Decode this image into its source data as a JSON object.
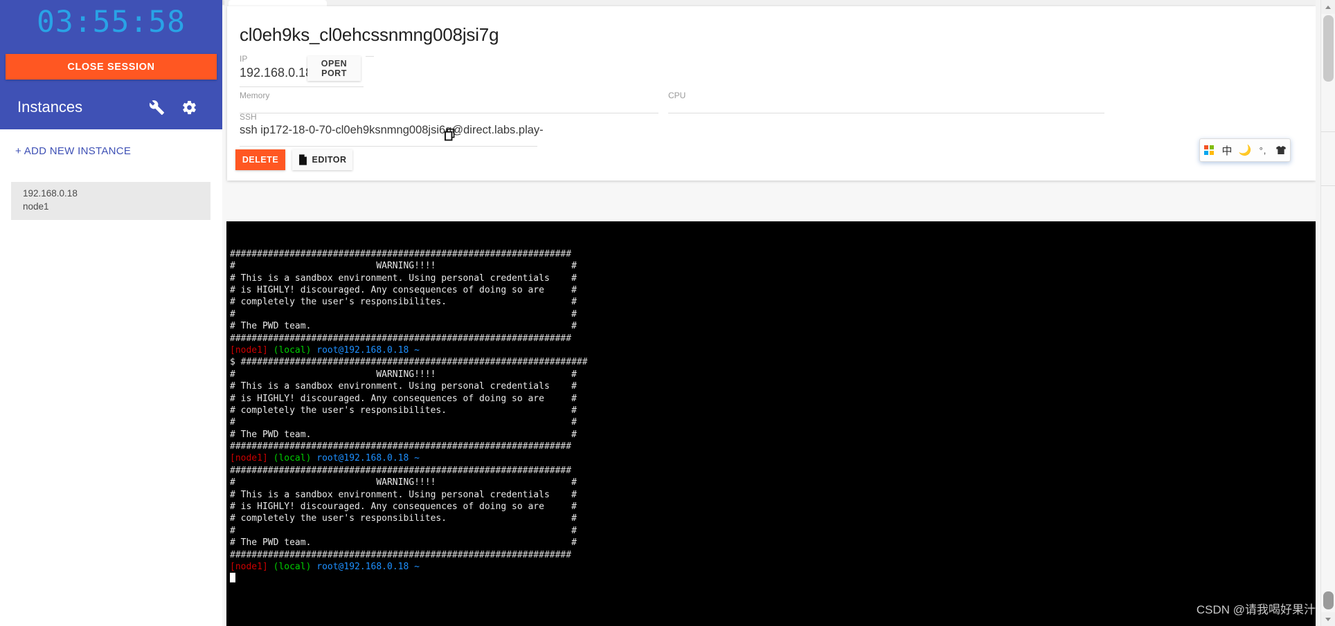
{
  "window": {
    "watermark": "CSDN @请我喝好果汁"
  },
  "sidebar": {
    "timer": "03:55:58",
    "close_session_label": "CLOSE SESSION",
    "instances_title": "Instances",
    "wrench_icon": "wrench-icon",
    "gear_icon": "gear-icon",
    "add_instance_label": "+ ADD NEW INSTANCE",
    "instances": [
      {
        "ip": "192.168.0.18",
        "name": "node1"
      }
    ]
  },
  "detail": {
    "title": "cl0eh9ks_cl0ehcssnmng008jsi7g",
    "ip": {
      "label": "IP",
      "value": "192.168.0.18"
    },
    "memory": {
      "label": "Memory",
      "value": ""
    },
    "cpu": {
      "label": "CPU",
      "value": ""
    },
    "ssh": {
      "label": "SSH",
      "value": "ssh ip172-18-0-70-cl0eh9ksnmng008jsi6g@direct.labs.play-"
    },
    "open_port_label": "OPEN PORT",
    "copy_icon": "copy-icon",
    "delete_label": "DELETE",
    "editor_label": "EDITOR",
    "editor_icon": "file-icon"
  },
  "terminal": {
    "banner_rule": "###############################################################",
    "banner": [
      "#                          WARNING!!!!                         #",
      "# This is a sandbox environment. Using personal credentials    #",
      "# is HIGHLY! discouraged. Any consequences of doing so are     #",
      "# completely the user's responsibilites.                       #",
      "#                                                              #",
      "# The PWD team.                                                #"
    ],
    "prompt": {
      "host": "[node1]",
      "scope": "(local)",
      "user": "root@192.168.0.18 ~",
      "sigil": "$"
    },
    "long_rule": "################################################################",
    "colors": {
      "background": "#000000",
      "host": "#cd0000",
      "scope": "#00cd00",
      "user": "#1e90ff",
      "text": "#e8e8e8"
    }
  },
  "ime": {
    "windows_icon": "windows-logo-icon",
    "language": "中",
    "moon_icon": "moon-icon",
    "punctuation": "°,",
    "shirt_icon": "shirt-icon"
  }
}
